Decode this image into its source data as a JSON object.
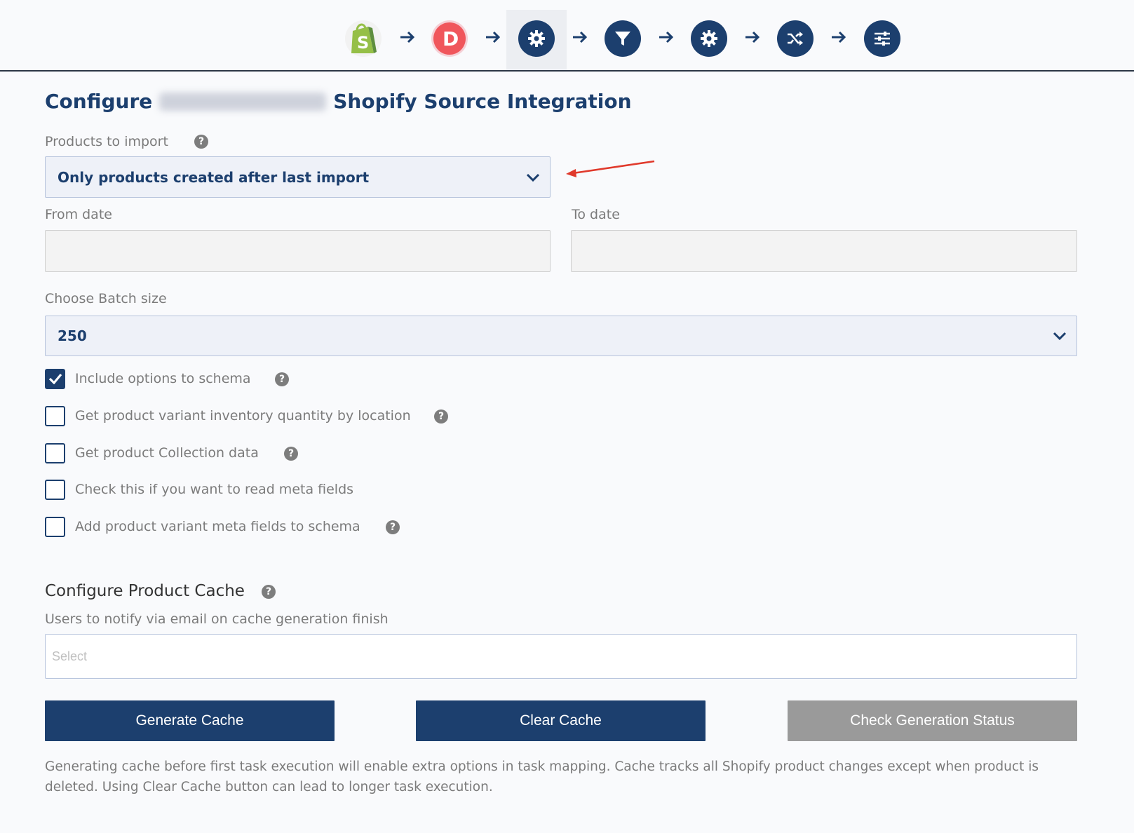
{
  "pipeline": {
    "steps": [
      {
        "icon": "shopify-logo-icon",
        "kind": "source"
      },
      {
        "icon": "d-letter-logo-icon",
        "kind": "destination",
        "letter": "D"
      },
      {
        "icon": "gear-icon",
        "kind": "configure",
        "active": true
      },
      {
        "icon": "filter-icon",
        "kind": "filter"
      },
      {
        "icon": "gear-icon",
        "kind": "settings"
      },
      {
        "icon": "shuffle-icon",
        "kind": "mapping"
      },
      {
        "icon": "sliders-icon",
        "kind": "options"
      }
    ],
    "colors": {
      "step": "#1c3f6e",
      "shopify_green": "#95bf47",
      "d_logo": "#f0565c"
    }
  },
  "title": {
    "prefix": "Configure",
    "suffix": "Shopify Source Integration"
  },
  "products_import": {
    "label": "Products to import",
    "value": "Only products created after last import"
  },
  "dates": {
    "from_label": "From date",
    "to_label": "To date",
    "from_value": "",
    "to_value": ""
  },
  "batch": {
    "label": "Choose Batch size",
    "value": "250"
  },
  "checkboxes": [
    {
      "label": "Include options to schema",
      "checked": true,
      "help": true
    },
    {
      "label": "Get product variant inventory quantity by location",
      "checked": false,
      "help": true
    },
    {
      "label": "Get product Collection data",
      "checked": false,
      "help": true
    },
    {
      "label": "Check this if you want to read meta fields",
      "checked": false,
      "help": false
    },
    {
      "label": "Add product variant meta fields to schema",
      "checked": false,
      "help": true
    }
  ],
  "cache": {
    "section_title": "Configure Product Cache",
    "notify_label": "Users to notify via email on cache generation finish",
    "notify_placeholder": "Select",
    "generate_label": "Generate Cache",
    "clear_label": "Clear Cache",
    "status_label": "Check Generation Status",
    "footnote": "Generating cache before first task execution will enable extra options in task mapping. Cache tracks all Shopify product changes except when product is deleted. Using Clear Cache button can lead to longer task execution."
  },
  "help_glyph": "?",
  "colors": {
    "primary": "#1c3f6e",
    "disabled_button": "#9a9a9a",
    "annotation_arrow": "#e0392b"
  }
}
